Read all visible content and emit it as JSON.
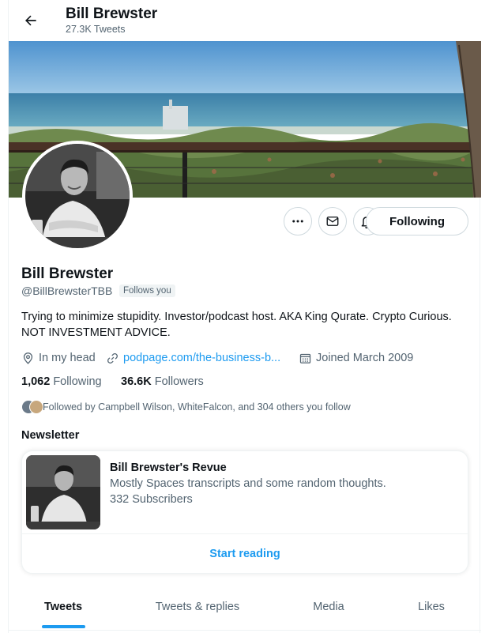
{
  "header": {
    "name": "Bill Brewster",
    "tweet_count": "27.3K Tweets"
  },
  "profile": {
    "display_name": "Bill Brewster",
    "handle": "@BillBrewsterTBB",
    "follows_you": "Follows you",
    "bio": "Trying to minimize stupidity. Investor/podcast host. AKA King Qurate. Crypto Curious. NOT INVESTMENT ADVICE.",
    "location": "In my head",
    "website": "podpage.com/the-business-b...",
    "joined": "Joined March 2009",
    "following_count": "1,062",
    "following_label": "Following",
    "followers_count": "36.6K",
    "followers_label": "Followers",
    "followed_by": "Followed by Campbell Wilson, WhiteFalcon, and 304 others you follow"
  },
  "actions": {
    "following_button": "Following",
    "more_icon": "more-horizontal-icon",
    "message_icon": "envelope-icon",
    "notify_icon": "bell-plus-icon"
  },
  "newsletter": {
    "section_title": "Newsletter",
    "name": "Bill Brewster's Revue",
    "description": "Mostly Spaces transcripts and some random thoughts.",
    "subscribers": "332 Subscribers",
    "cta": "Start reading"
  },
  "tabs": [
    {
      "label": "Tweets",
      "active": true
    },
    {
      "label": "Tweets & replies",
      "active": false
    },
    {
      "label": "Media",
      "active": false
    },
    {
      "label": "Likes",
      "active": false
    }
  ],
  "colors": {
    "accent": "#1d9bf0",
    "text": "#0f1419",
    "secondary": "#536471",
    "border": "#cfd9de"
  }
}
